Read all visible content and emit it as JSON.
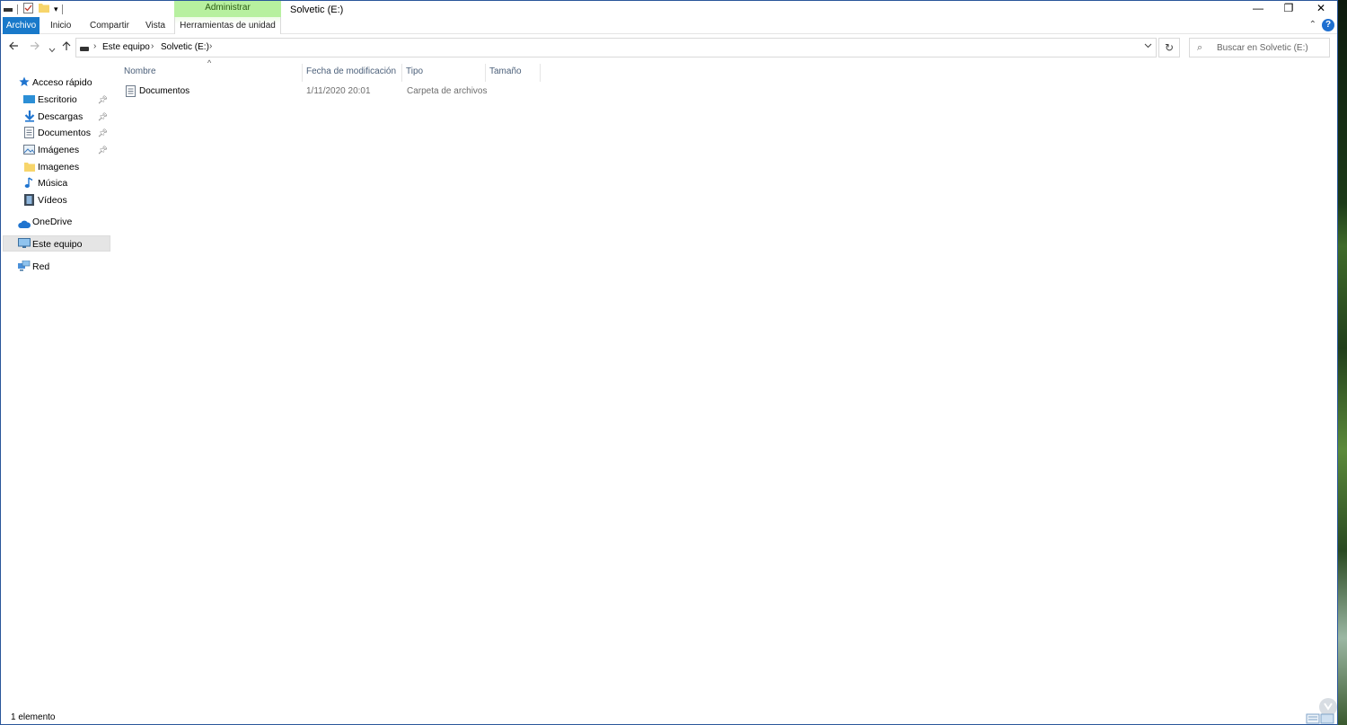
{
  "window": {
    "title": "Solvetic (E:)",
    "controls": {
      "minimize": "—",
      "restore": "❐",
      "close": "✕"
    }
  },
  "ribbon": {
    "context_header": "Administrar",
    "tabs": [
      {
        "label": "Archivo"
      },
      {
        "label": "Inicio"
      },
      {
        "label": "Compartir"
      },
      {
        "label": "Vista"
      },
      {
        "label": "Herramientas de unidad"
      }
    ],
    "help_label": "?"
  },
  "address": {
    "crumbs": [
      "Este equipo",
      "Solvetic (E:)"
    ]
  },
  "search": {
    "placeholder": "Buscar en Solvetic (E:)"
  },
  "navpane": {
    "items": [
      {
        "label": "Acceso rápido",
        "icon": "star-icon"
      },
      {
        "label": "Escritorio",
        "icon": "desktop-icon",
        "pinned": true
      },
      {
        "label": "Descargas",
        "icon": "download-icon",
        "pinned": true
      },
      {
        "label": "Documentos",
        "icon": "documents-icon",
        "pinned": true
      },
      {
        "label": "Imágenes",
        "icon": "pictures-icon",
        "pinned": true
      },
      {
        "label": "Imagenes",
        "icon": "folder-icon"
      },
      {
        "label": "Música",
        "icon": "music-icon"
      },
      {
        "label": "Vídeos",
        "icon": "videos-icon"
      },
      {
        "label": "OneDrive",
        "icon": "cloud-icon"
      },
      {
        "label": "Este equipo",
        "icon": "computer-icon",
        "selected": true
      },
      {
        "label": "Red",
        "icon": "network-icon"
      }
    ]
  },
  "columns": [
    "Nombre",
    "Fecha de modificación",
    "Tipo",
    "Tamaño"
  ],
  "files": [
    {
      "name": "Documentos",
      "modified": "1/11/2020 20:01",
      "type": "Carpeta de archivos",
      "size": ""
    }
  ],
  "status": {
    "text": "1 elemento"
  },
  "colors": {
    "accent": "#1979ca",
    "context_tab": "#b7f09f",
    "selection": "#e5e5e5"
  }
}
